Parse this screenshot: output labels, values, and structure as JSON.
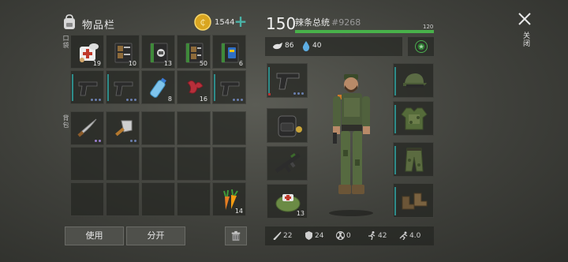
{
  "inventory": {
    "title": "物品栏",
    "coins": "1544",
    "add_label": "+",
    "pocket_label": "口袋",
    "backpack_label": "背包",
    "pocket_slots": [
      {
        "icon": "medkit-icon",
        "qty": "19"
      },
      {
        "icon": "guidebook-icon",
        "qty": "10"
      },
      {
        "icon": "recipe-book-icon",
        "qty": "13"
      },
      {
        "icon": "guidebook-icon",
        "qty": "50"
      },
      {
        "icon": "recipe-book-blue-icon",
        "qty": "6"
      },
      {
        "icon": "pistol-icon",
        "qty": ""
      },
      {
        "icon": "pistol-icon",
        "qty": ""
      },
      {
        "icon": "water-bottle-icon",
        "qty": "8"
      },
      {
        "icon": "meat-icon",
        "qty": "16"
      },
      {
        "icon": "pistol-icon",
        "qty": ""
      }
    ],
    "backpack_slots": [
      {
        "icon": "machete-icon",
        "qty": ""
      },
      {
        "icon": "cleaver-icon",
        "qty": ""
      },
      {
        "icon": "",
        "qty": ""
      },
      {
        "icon": "",
        "qty": ""
      },
      {
        "icon": "",
        "qty": ""
      },
      {
        "icon": "",
        "qty": ""
      },
      {
        "icon": "",
        "qty": ""
      },
      {
        "icon": "",
        "qty": ""
      },
      {
        "icon": "",
        "qty": ""
      },
      {
        "icon": "",
        "qty": ""
      },
      {
        "icon": "",
        "qty": ""
      },
      {
        "icon": "",
        "qty": ""
      },
      {
        "icon": "",
        "qty": ""
      },
      {
        "icon": "",
        "qty": ""
      },
      {
        "icon": "carrot-icon",
        "qty": "14"
      }
    ],
    "use_label": "使用",
    "split_label": "分开"
  },
  "player": {
    "level": "150",
    "name": "辣条总统",
    "id": "#9268",
    "xp_max": "120",
    "xp_fraction": 1.0,
    "food": "86",
    "water": "40"
  },
  "equipment": {
    "left": [
      {
        "icon": "pistol-icon",
        "qty": ""
      },
      {
        "icon": "backpack-icon",
        "qty": ""
      },
      {
        "icon": "rifle-icon",
        "qty": ""
      },
      {
        "icon": "first-aid-bag-icon",
        "qty": "13"
      }
    ],
    "right": [
      {
        "icon": "military-cap-icon"
      },
      {
        "icon": "camo-vest-icon"
      },
      {
        "icon": "camo-pants-icon"
      },
      {
        "icon": "boots-icon"
      }
    ]
  },
  "attributes": {
    "attack": "22",
    "defense": "24",
    "radiation": "0",
    "speed": "42",
    "stealth": "4.0"
  },
  "close_label": "关闭",
  "colors": {
    "xp": "#48b14a",
    "accent": "#4ab3a7",
    "coin": "#d9a520"
  }
}
